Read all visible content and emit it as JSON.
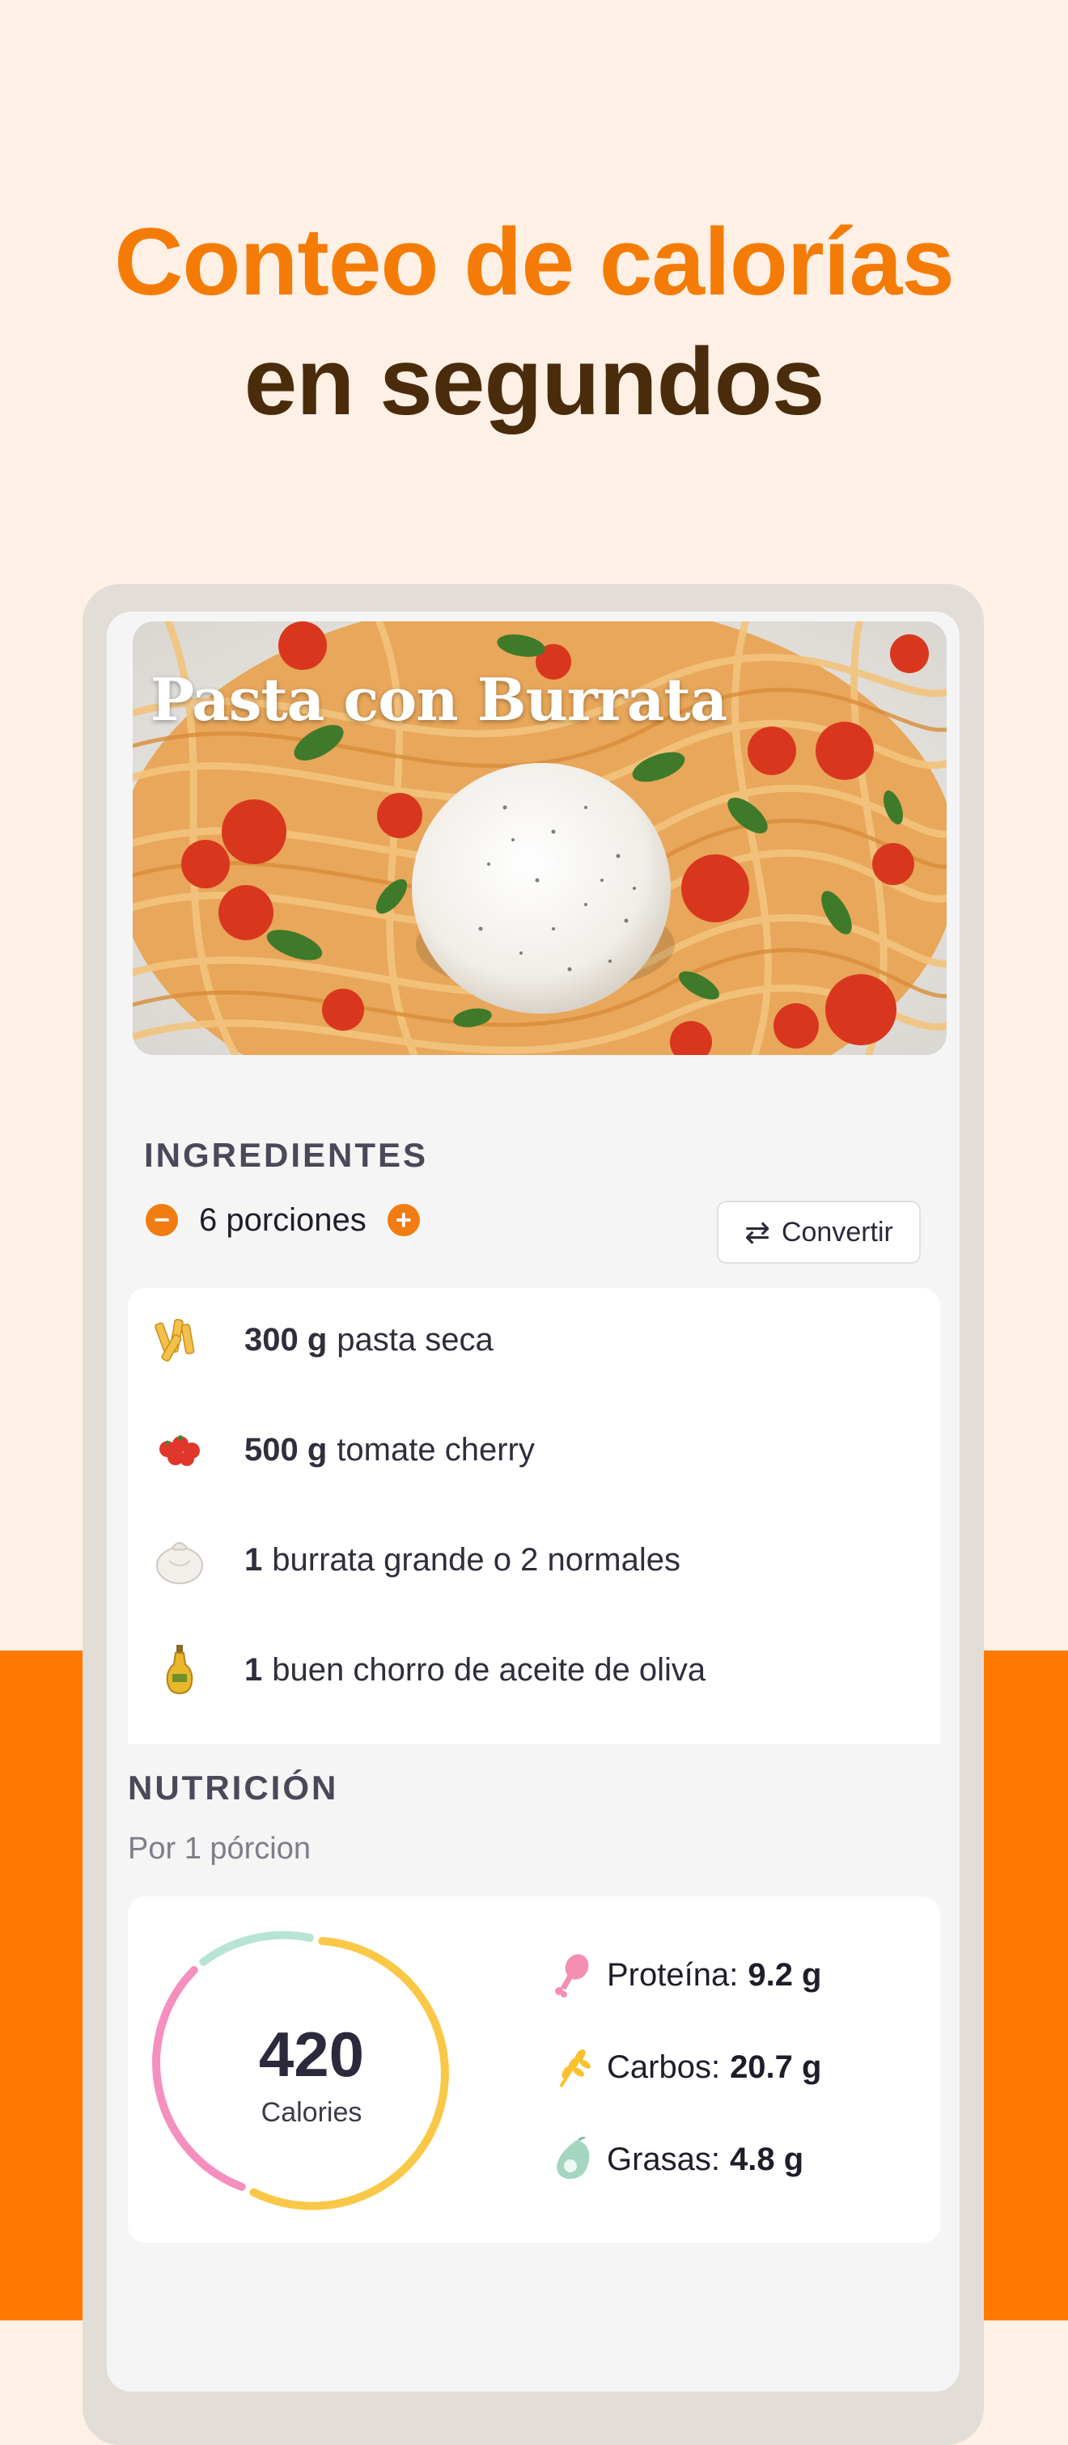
{
  "headline": {
    "line1": "Conteo de calorías",
    "line2": "en segundos"
  },
  "recipe": {
    "title": "Pasta con Burrata"
  },
  "ingredients": {
    "section_title": "INGREDIENTES",
    "servings_label": "6 porciones",
    "decrease_symbol": "−",
    "increase_symbol": "+",
    "convert_label": "Convertir",
    "items": [
      {
        "qty": "300 g",
        "name": "pasta seca",
        "icon": "pasta-icon"
      },
      {
        "qty": "500 g",
        "name": "tomate cherry",
        "icon": "tomato-icon"
      },
      {
        "qty": "1",
        "name": "burrata grande o 2 normales",
        "icon": "burrata-icon"
      },
      {
        "qty": "1",
        "name": "buen chorro de aceite de oliva",
        "icon": "olive-oil-icon"
      }
    ]
  },
  "nutrition": {
    "section_title": "NUTRICIÓN",
    "subtitle": "Por 1 pórcion",
    "calories_value": "420",
    "calories_label": "Calories",
    "macros": [
      {
        "label": "Proteína:",
        "value": "9.2 g",
        "icon": "drumstick-icon",
        "color": "#F48FB1"
      },
      {
        "label": "Carbos:",
        "value": "20.7 g",
        "icon": "wheat-icon",
        "color": "#FBC02D"
      },
      {
        "label": "Grasas:",
        "value": "4.8 g",
        "icon": "avocado-icon",
        "color": "#A5D6C0"
      }
    ]
  },
  "colors": {
    "accent_orange": "#FF7A00",
    "headline_orange": "#F47C06",
    "headline_brown": "#4A2C0C",
    "background_cream": "#FEF0E5"
  }
}
